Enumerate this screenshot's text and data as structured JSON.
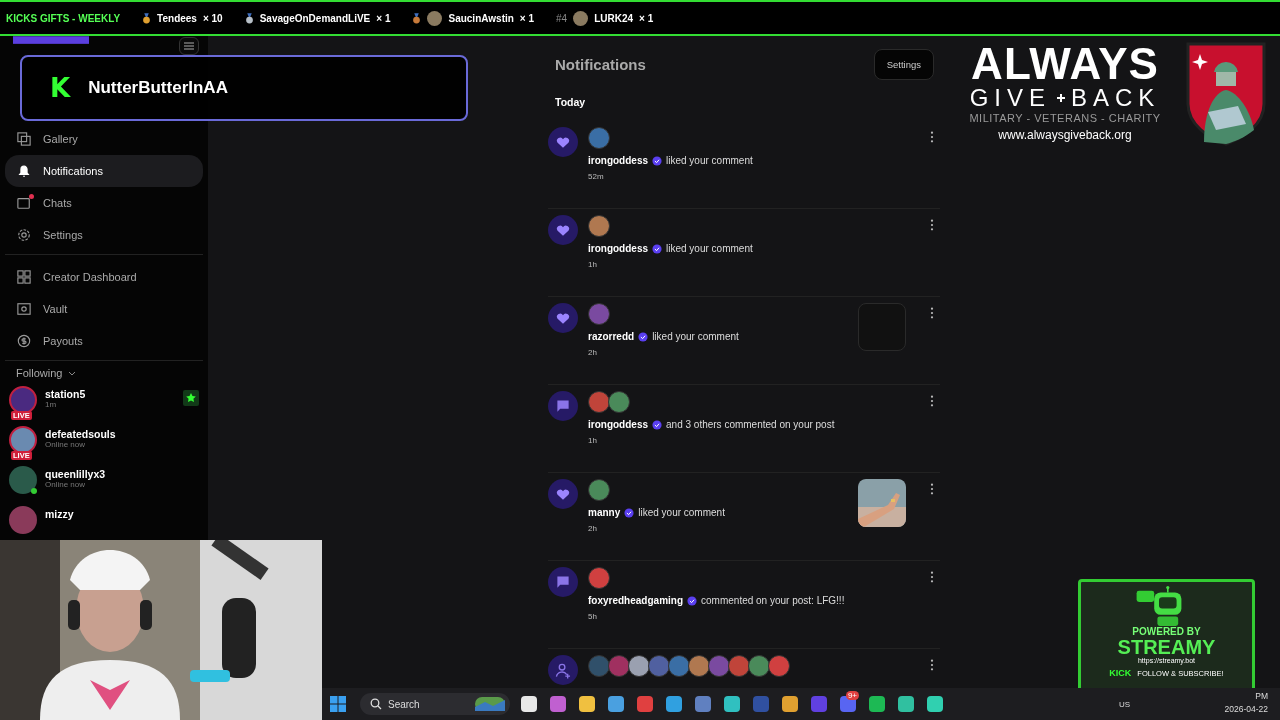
{
  "ticker": {
    "title": "KICKS GIFTS - WEEKLY",
    "entries": [
      {
        "kind": "medal",
        "color": "#e0a030",
        "avatar": false,
        "name": "Tendees",
        "count": "× 10"
      },
      {
        "kind": "medal",
        "color": "#b8c0c8",
        "avatar": false,
        "name": "SavageOnDemandLiVE",
        "count": "× 1"
      },
      {
        "kind": "medal",
        "color": "#c77a3a",
        "avatar": true,
        "name": "SaucinAwstin",
        "count": "× 1"
      },
      {
        "kind": "rank",
        "rank": "#4",
        "avatar": true,
        "name": "LURK24",
        "count": "× 1"
      }
    ]
  },
  "alert": {
    "logo": "K",
    "name": "NutterButterInAA"
  },
  "sidebar": {
    "sections": [
      [
        {
          "label": "Gallery",
          "selected": false,
          "unread": false
        },
        {
          "label": "Notifications",
          "selected": true,
          "unread": false
        },
        {
          "label": "Chats",
          "selected": false,
          "unread": true
        },
        {
          "label": "Settings",
          "selected": false,
          "unread": false
        }
      ],
      [
        {
          "label": "Creator Dashboard",
          "selected": false,
          "unread": false
        },
        {
          "label": "Vault",
          "selected": false,
          "unread": false
        },
        {
          "label": "Payouts",
          "selected": false,
          "unread": false
        }
      ]
    ],
    "following": {
      "label": "Following",
      "users": [
        {
          "name": "station5",
          "status": "1m",
          "badge": "LIVE",
          "starred": true
        },
        {
          "name": "defeatedsouls",
          "status": "Online now",
          "badge": "LIVE"
        },
        {
          "name": "queenlillyx3",
          "status": "Online now",
          "online": true
        },
        {
          "name": "mizzy"
        }
      ]
    }
  },
  "main": {
    "title": "Notifications",
    "settings_button": "Settings",
    "section": "Today",
    "items": [
      {
        "kind": "like",
        "name": "irongoddess",
        "verified": true,
        "text": "liked your comment",
        "time": "52m"
      },
      {
        "kind": "like",
        "name": "irongoddess",
        "verified": true,
        "text": "liked your comment",
        "time": "1h"
      },
      {
        "kind": "like",
        "name": "razorredd",
        "verified": true,
        "text": "liked your comment",
        "time": "2h",
        "thumbnail": {
          "kind": "card"
        }
      },
      {
        "kind": "comment",
        "name": "irongoddess",
        "verified": true,
        "text": "and 3 others commented on your post",
        "time": "1h"
      },
      {
        "kind": "like",
        "name": "manny",
        "verified": true,
        "text": "liked your comment",
        "time": "2h"
      },
      {
        "kind": "comment",
        "name": "foxyredheadgaming",
        "verified": true,
        "text": "commented on your post: LFG!!!",
        "time": "5h"
      },
      {
        "kind": "follow"
      }
    ]
  },
  "logo": {
    "line1": "ALWAYS",
    "line2a": "GIVE",
    "line2b": "BACK",
    "tagline": "MILITARY - VETERANS - CHARITY",
    "url": "www.alwaysgiveback.org"
  },
  "streamy": {
    "powered": "POWERED BY",
    "name": "STREAMY",
    "url": "https://streamy.bot",
    "kick": "KICK",
    "cta": "FOLLOW & SUBSCRIBE!"
  },
  "taskbar": {
    "search_placeholder": "Search",
    "chat_badge": "9+",
    "language": "US",
    "time": "PM",
    "date": "2026-04-22"
  }
}
